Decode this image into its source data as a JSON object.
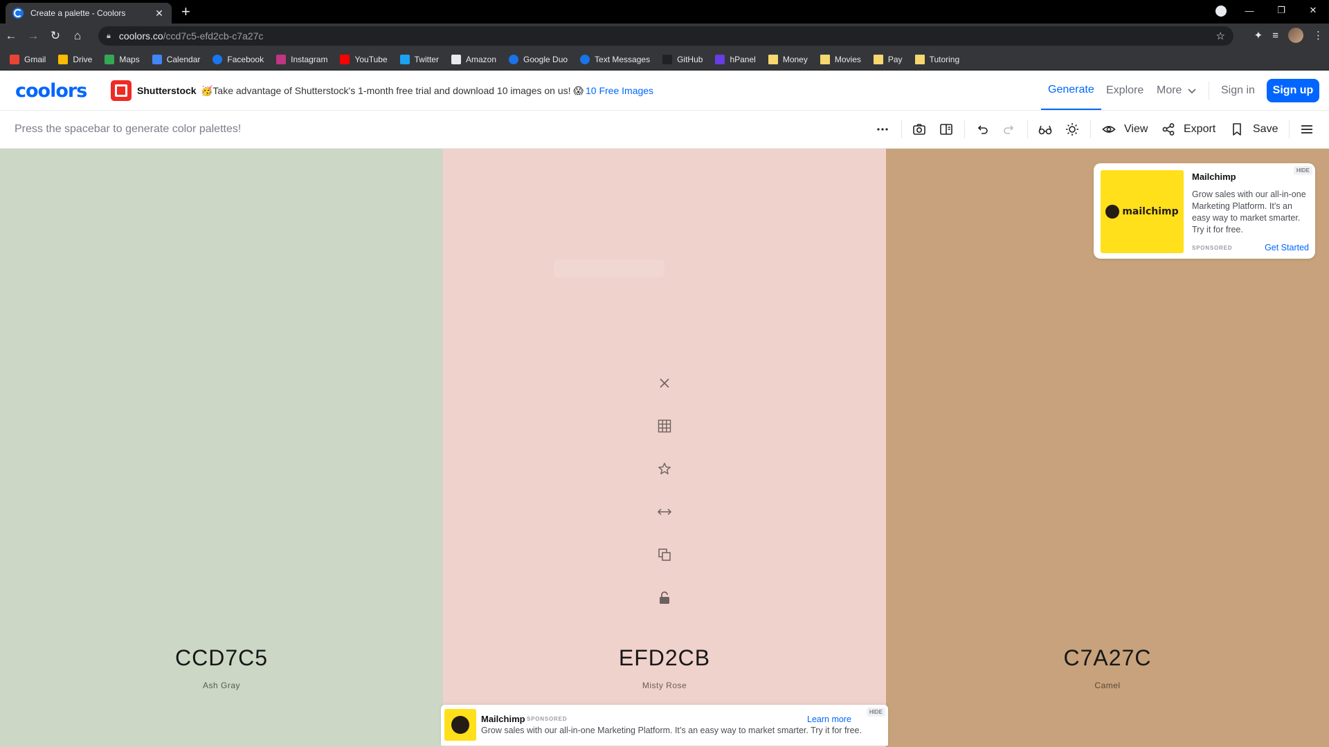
{
  "browser": {
    "tab_title": "Create a palette - Coolors",
    "tab_close": "✕",
    "new_tab": "+",
    "url_host": "coolors.co",
    "url_path": "/ccd7c5-efd2cb-c7a27c",
    "bookmarks": [
      {
        "label": "Gmail",
        "icon": "gmail-icon",
        "color": "#ea4335"
      },
      {
        "label": "Drive",
        "icon": "drive-icon",
        "color": "#fbbc04"
      },
      {
        "label": "Maps",
        "icon": "maps-icon",
        "color": "#34a853"
      },
      {
        "label": "Calendar",
        "icon": "calendar-icon",
        "color": "#4285f4"
      },
      {
        "label": "Facebook",
        "icon": "facebook-icon",
        "color": "#1877f2"
      },
      {
        "label": "Instagram",
        "icon": "instagram-icon",
        "color": "#c13584"
      },
      {
        "label": "YouTube",
        "icon": "youtube-icon",
        "color": "#ff0000"
      },
      {
        "label": "Twitter",
        "icon": "twitter-icon",
        "color": "#1da1f2"
      },
      {
        "label": "Amazon",
        "icon": "amazon-icon",
        "color": "#e8eaed"
      },
      {
        "label": "Google Duo",
        "icon": "duo-icon",
        "color": "#1a73e8"
      },
      {
        "label": "Text Messages",
        "icon": "messages-icon",
        "color": "#1a73e8"
      },
      {
        "label": "GitHub",
        "icon": "github-icon",
        "color": "#202124"
      },
      {
        "label": "hPanel",
        "icon": "hpanel-icon",
        "color": "#673de6"
      },
      {
        "label": "Money",
        "icon": "folder-icon",
        "color": "#f6d770"
      },
      {
        "label": "Movies",
        "icon": "folder-icon",
        "color": "#f6d770"
      },
      {
        "label": "Pay",
        "icon": "folder-icon",
        "color": "#f6d770"
      },
      {
        "label": "Tutoring",
        "icon": "folder-icon",
        "color": "#f6d770"
      }
    ]
  },
  "header": {
    "logo": "coolors",
    "sponsor_name": "Shutterstock",
    "promo_text": "🥳Take advantage of Shutterstock's 1-month free trial and download 10 images on us! 😱",
    "promo_link": "10 Free Images",
    "nav": {
      "generate": "Generate",
      "explore": "Explore",
      "more": "More",
      "signin": "Sign in",
      "signup": "Sign up"
    },
    "accent_color": "#0066ff"
  },
  "toolbar": {
    "hint": "Press the spacebar to generate color palettes!",
    "view_label": "View",
    "export_label": "Export",
    "save_label": "Save"
  },
  "palette": {
    "colors": [
      {
        "hex": "CCD7C5",
        "name": "Ash Gray",
        "color": "#ccd7c5"
      },
      {
        "hex": "EFD2CB",
        "name": "Misty Rose",
        "color": "#efd2cb"
      },
      {
        "hex": "C7A27C",
        "name": "Camel",
        "color": "#c7a27c"
      }
    ]
  },
  "ad_card": {
    "brand_mark": "mailchimp",
    "title": "Mailchimp",
    "body": "Grow sales with our all-in-one Marketing Platform. It’s an easy way to market smarter. Try it for free.",
    "sponsored": "SPONSORED",
    "cta": "Get Started",
    "hide": "HIDE"
  },
  "ad_banner": {
    "brand_mark": "mailchimp",
    "title": "Mailchimp",
    "sponsored": "SPONSORED",
    "body": "Grow sales with our all-in-one Marketing Platform. It’s an easy way to market smarter. Try it for free.",
    "cta": "Learn more",
    "hide": "HIDE"
  }
}
